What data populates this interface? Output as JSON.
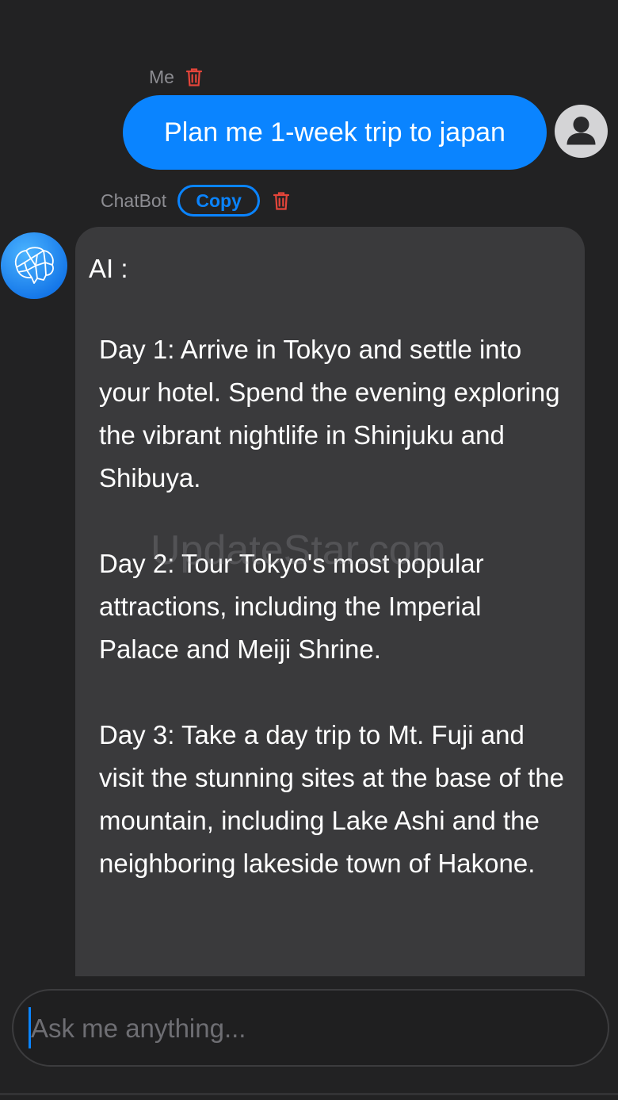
{
  "user": {
    "label": "Me",
    "message": "Plan me 1-week trip to japan"
  },
  "bot": {
    "label": "ChatBot",
    "copy_label": "Copy",
    "prefix": "AI :",
    "paragraphs": [
      "Day 1: Arrive in Tokyo and settle into your hotel. Spend the evening exploring the vibrant nightlife in Shinjuku and Shibuya.",
      "Day 2: Tour Tokyo's most popular attractions, including the Imperial Palace and Meiji Shrine.",
      "Day 3: Take a day trip to Mt. Fuji and visit the stunning sites at the base of the mountain, including Lake Ashi and the neighboring lakeside town of Hakone."
    ]
  },
  "watermark": "UpdateStar.com",
  "input": {
    "placeholder": "Ask me anything..."
  },
  "colors": {
    "accent": "#0a84ff",
    "delete": "#e5453a",
    "background": "#222223",
    "bot_bubble": "#3a3a3c"
  },
  "icons": {
    "delete": "trash-icon",
    "user_avatar": "user-silhouette-icon",
    "bot_avatar": "brain-network-icon"
  }
}
